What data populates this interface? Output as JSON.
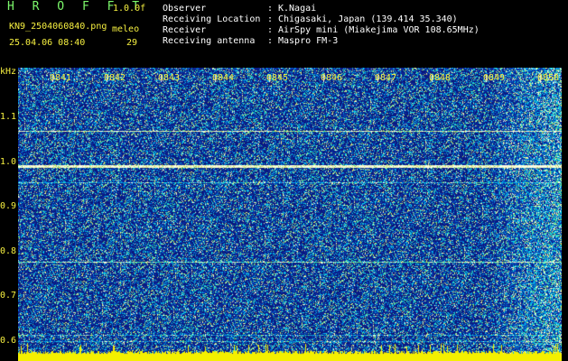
{
  "header": {
    "title": "H R O F F T",
    "version": "1.0.0f",
    "filename": "KN9_2504060840.png",
    "datetime": "25.04.06 08:40",
    "meleo_label": "meleo",
    "meleo_value": "29",
    "info": [
      {
        "key": "Observer",
        "value": "K.Nagai"
      },
      {
        "key": "Receiving Location",
        "value": "Chigasaki, Japan (139.414 35.340)"
      },
      {
        "key": "Receiver",
        "value": "AirSpy mini (Miakejima VOR 108.65MHz)"
      },
      {
        "key": "Receiving antenna",
        "value": "Maspro FM-3"
      }
    ]
  },
  "axis": {
    "y_unit": "kHz",
    "y_ticks": [
      "1.1",
      "1.0",
      "0.9",
      "0.8",
      "0.7",
      "0.6"
    ],
    "x_ticks": [
      "0841",
      "0842",
      "0843",
      "0844",
      "0845",
      "0846",
      "0847",
      "0848",
      "0849",
      "0850"
    ]
  },
  "colors": {
    "background_noise": "#1a2aa0",
    "signal_line": "#7ce0ff",
    "label_yellow": "#f6f040",
    "label_green": "#7cf86b"
  }
}
